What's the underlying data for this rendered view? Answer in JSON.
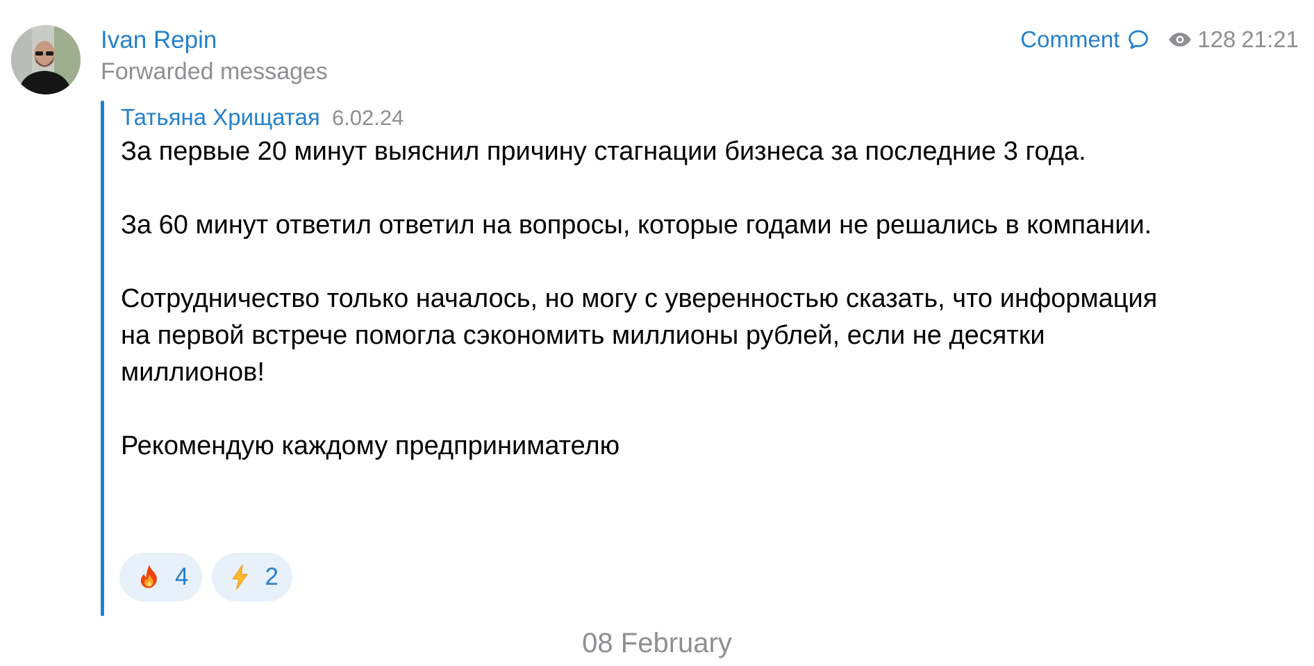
{
  "post": {
    "sender_name": "Ivan Repin",
    "subtitle": "Forwarded messages",
    "comment_label": "Comment",
    "views": "128",
    "time": "21:21"
  },
  "forwarded": {
    "author": "Татьяна Хрищатая",
    "date": "6.02.24",
    "paragraphs": [
      "За первые 20 минут выяснил причину стагнации бизнеса за последние 3 года.",
      "За 60 минут ответил ответил на вопросы, которые годами не решались в компании.",
      "Сотрудничество только началось, но могу с уверенностью сказать, что информация на первой встрече помогла сэкономить миллионы рублей, если не десятки миллионов!",
      "Рекомендую каждому предпринимателю"
    ]
  },
  "reactions": [
    {
      "emoji": "fire-icon",
      "count": "4"
    },
    {
      "emoji": "lightning-icon",
      "count": "2"
    }
  ],
  "date_separator": "08 February",
  "colors": {
    "accent": "#2481cc",
    "muted": "#8e8e93",
    "reaction_bg": "#e8f1f9"
  }
}
